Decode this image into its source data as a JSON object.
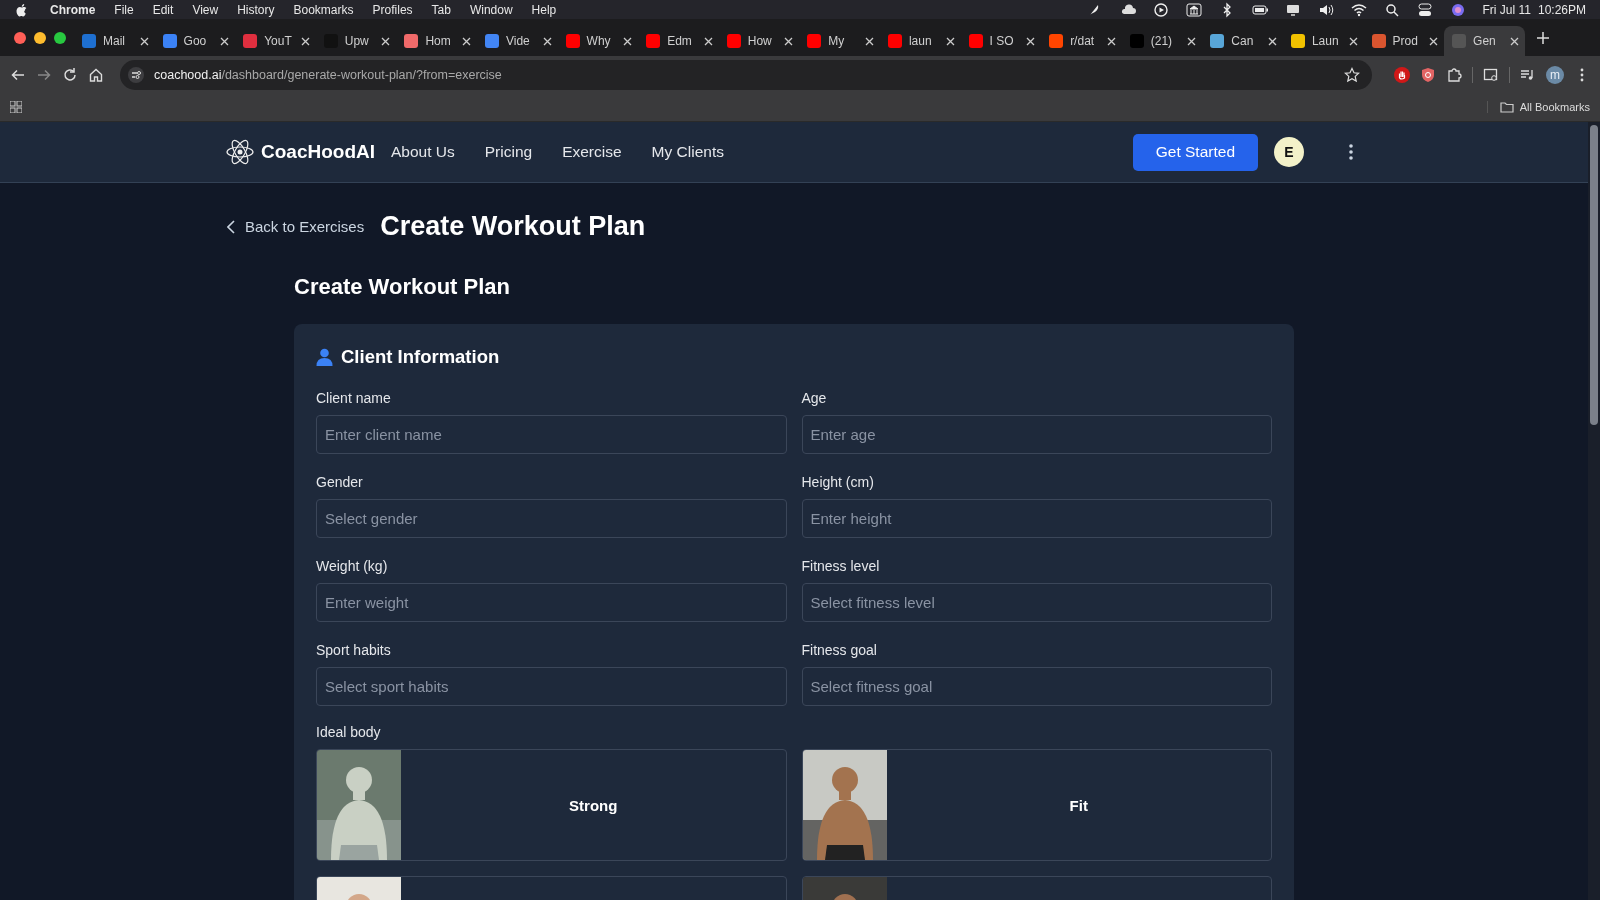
{
  "menu_bar": {
    "app": "Chrome",
    "items": [
      "File",
      "Edit",
      "View",
      "History",
      "Bookmarks",
      "Profiles",
      "Tab",
      "Window",
      "Help"
    ],
    "date": "Fri Jul 11",
    "time": "10:26PM"
  },
  "tabs": [
    {
      "title": "Mail",
      "selected": false
    },
    {
      "title": "Goo",
      "selected": false
    },
    {
      "title": "YouT",
      "selected": false
    },
    {
      "title": "Upw",
      "selected": false
    },
    {
      "title": "Hom",
      "selected": false
    },
    {
      "title": "Vide",
      "selected": false
    },
    {
      "title": "Why",
      "selected": false
    },
    {
      "title": "Edm",
      "selected": false
    },
    {
      "title": "How",
      "selected": false
    },
    {
      "title": "My",
      "selected": false
    },
    {
      "title": "laun",
      "selected": false
    },
    {
      "title": "I SO",
      "selected": false
    },
    {
      "title": "r/dat",
      "selected": false
    },
    {
      "title": "(21)",
      "selected": false
    },
    {
      "title": "Can",
      "selected": false
    },
    {
      "title": "Laun",
      "selected": false
    },
    {
      "title": "Prod",
      "selected": false
    },
    {
      "title": "Gen",
      "selected": true
    }
  ],
  "address_bar": {
    "url": "**coachood.ai**/dashboard/generate-workout-plan/?from=exercise"
  },
  "profile": {
    "initial": "m"
  },
  "bookmarks_bar": {
    "all_bookmarks": "All Bookmarks"
  },
  "site_nav": {
    "brand": "CoacHoodAI",
    "links": [
      "About Us",
      "Pricing",
      "Exercise",
      "My Clients"
    ],
    "cta": "Get Started",
    "avatar": "E"
  },
  "page": {
    "back_link": "Back to Exercises",
    "title": "Create Workout Plan",
    "subtitle": "Create Workout Plan"
  },
  "client_information": {
    "heading": "Client Information",
    "fields": [
      {
        "label": "Client name",
        "placeholder": "Enter client name"
      },
      {
        "label": "Age",
        "placeholder": "Enter age"
      },
      {
        "label": "Gender",
        "placeholder": "Select gender"
      },
      {
        "label": "Height (cm)",
        "placeholder": "Enter height"
      },
      {
        "label": "Weight (kg)",
        "placeholder": "Enter weight"
      },
      {
        "label": "Fitness level",
        "placeholder": "Select fitness level"
      },
      {
        "label": "Sport habits",
        "placeholder": "Select sport habits"
      },
      {
        "label": "Fitness goal",
        "placeholder": "Select fitness goal"
      }
    ],
    "ideal_body": {
      "label": "Ideal body",
      "options": [
        {
          "kind": "labeled",
          "label": "Strong"
        },
        {
          "kind": "labeled",
          "label": "Fit"
        },
        {
          "kind": "picture"
        },
        {
          "kind": "picture"
        }
      ]
    }
  }
}
